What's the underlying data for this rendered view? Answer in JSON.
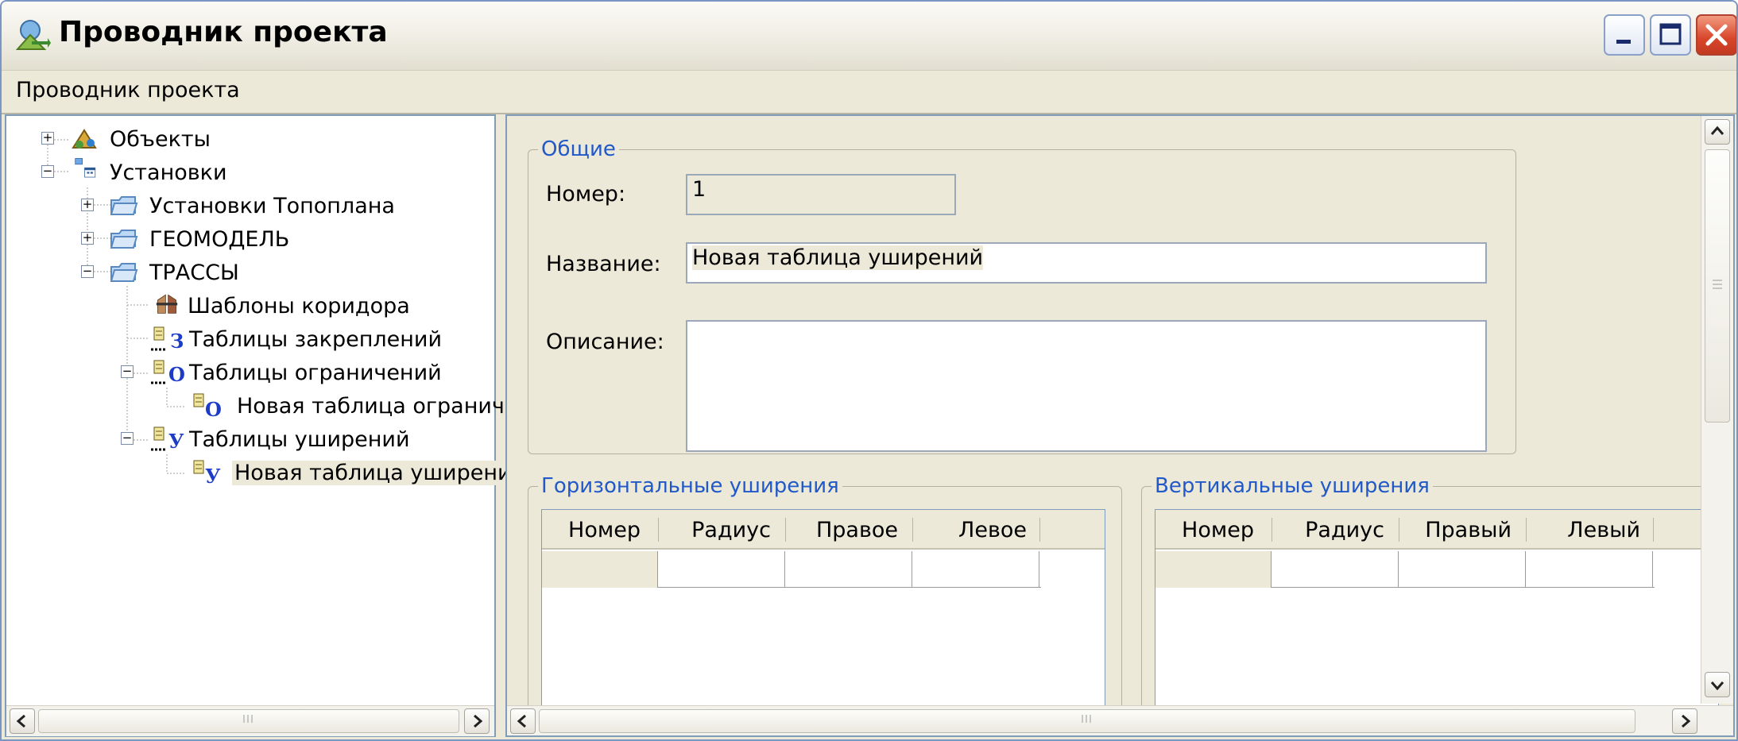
{
  "window": {
    "title": "Проводник проекта",
    "icon": "project-explorer-icon",
    "controls": [
      "minimize-icon",
      "maximize-icon",
      "close-icon"
    ]
  },
  "menu": {
    "items": [
      "Проводник проекта"
    ]
  },
  "tree": {
    "items": [
      {
        "label": "Объекты",
        "icon": "objects-icon",
        "expander": "+"
      },
      {
        "label": "Установки",
        "icon": "settings-icon",
        "expander": "−"
      },
      {
        "label": "Установки Топоплана",
        "icon": "folder-icon",
        "expander": "+"
      },
      {
        "label": "ГЕОМОДЕЛЬ",
        "icon": "folder-icon",
        "expander": "+"
      },
      {
        "label": "ТРАССЫ",
        "icon": "folder-icon",
        "expander": "−"
      },
      {
        "label": "Шаблоны коридора",
        "icon": "corridor-template-icon"
      },
      {
        "label": "Таблицы закреплений",
        "icon": "table-icon",
        "badge": "З"
      },
      {
        "label": "Таблицы ограничений",
        "icon": "table-icon",
        "badge": "О",
        "expander": "−"
      },
      {
        "label": "Новая таблица огранич",
        "icon": "table-icon",
        "badge": "О"
      },
      {
        "label": "Таблицы уширений",
        "icon": "table-icon",
        "badge": "У",
        "expander": "−"
      },
      {
        "label": "Новая таблица уширени",
        "icon": "table-icon",
        "badge": "У",
        "selected": true
      }
    ]
  },
  "form": {
    "general_title": "Общие",
    "number_label": "Номер:",
    "number_value": "1",
    "name_label": "Название:",
    "name_value": "Новая таблица уширений",
    "description_label": "Описание:",
    "description_value": ""
  },
  "horizontal": {
    "title": "Горизонтальные уширения",
    "columns": [
      "Номер",
      "Радиус",
      "Правое",
      "Левое"
    ]
  },
  "vertical": {
    "title": "Вертикальные уширения",
    "columns": [
      "Номер",
      "Радиус",
      "Правый",
      "Левый"
    ]
  },
  "colors": {
    "group_title": "#2259c9",
    "window_border": "#7a96c4",
    "close_button": "#d8452a",
    "background": "#ece9d8"
  }
}
